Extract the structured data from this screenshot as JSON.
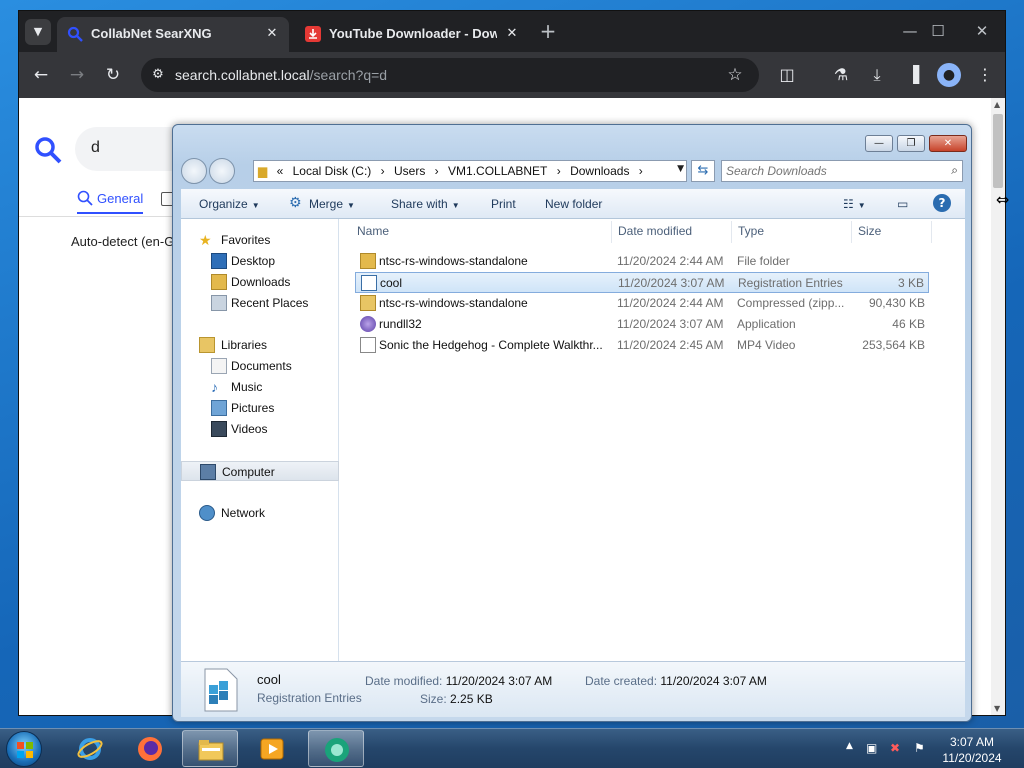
{
  "browser": {
    "tabs": [
      {
        "title": "CollabNet SearXNG",
        "active": true
      },
      {
        "title": "YouTube Downloader - Download",
        "active": false
      }
    ],
    "url_host": "search.collabnet.local",
    "url_path": "/search?q=d",
    "icons": [
      "tab-search-icon",
      "back-icon",
      "forward-icon",
      "reload-icon",
      "site-settings-icon",
      "bookmark-star-icon",
      "extensions-icon",
      "labs-icon",
      "download-icon",
      "side-panel-icon",
      "profile-icon",
      "menu-icon"
    ]
  },
  "page": {
    "query": "d",
    "category_general": "General",
    "autodetect": "Auto-detect (en-G"
  },
  "explorer": {
    "breadcrumbs": [
      "«",
      "Local Disk (C:)",
      "›",
      "Users",
      "›",
      "VM1.COLLABNET",
      "›",
      "Downloads",
      "›"
    ],
    "search_placeholder": "Search Downloads",
    "commands": {
      "organize": "Organize",
      "merge": "Merge",
      "share_with": "Share with",
      "print": "Print",
      "new_folder": "New folder"
    },
    "nav": {
      "favorites": "Favorites",
      "desktop": "Desktop",
      "downloads": "Downloads",
      "recent_places": "Recent Places",
      "libraries": "Libraries",
      "documents": "Documents",
      "music": "Music",
      "pictures": "Pictures",
      "videos": "Videos",
      "computer": "Computer",
      "network": "Network"
    },
    "columns": {
      "name": "Name",
      "date_modified": "Date modified",
      "type": "Type",
      "size": "Size"
    },
    "files": [
      {
        "name": "ntsc-rs-windows-standalone",
        "date": "11/20/2024 2:44 AM",
        "type": "File folder",
        "size": "",
        "icon": "folder-icon"
      },
      {
        "name": "cool",
        "date": "11/20/2024 3:07 AM",
        "type": "Registration Entries",
        "size": "3 KB",
        "icon": "registry-file-icon"
      },
      {
        "name": "ntsc-rs-windows-standalone",
        "date": "11/20/2024 2:44 AM",
        "type": "Compressed (zipp...",
        "size": "90,430 KB",
        "icon": "zip-folder-icon"
      },
      {
        "name": "rundll32",
        "date": "11/20/2024 3:07 AM",
        "type": "Application",
        "size": "46 KB",
        "icon": "application-icon"
      },
      {
        "name": "Sonic the Hedgehog - Complete Walkthr...",
        "date": "11/20/2024 2:45 AM",
        "type": "MP4 Video",
        "size": "253,564 KB",
        "icon": "video-file-icon"
      }
    ],
    "details": {
      "name": "cool",
      "type": "Registration Entries",
      "date_modified_label": "Date modified:",
      "date_modified": "11/20/2024 3:07 AM",
      "date_created_label": "Date created:",
      "date_created": "11/20/2024 3:07 AM",
      "size_label": "Size:",
      "size": "2.25 KB"
    }
  },
  "taskbar": {
    "time": "3:07 AM",
    "date": "11/20/2024"
  }
}
